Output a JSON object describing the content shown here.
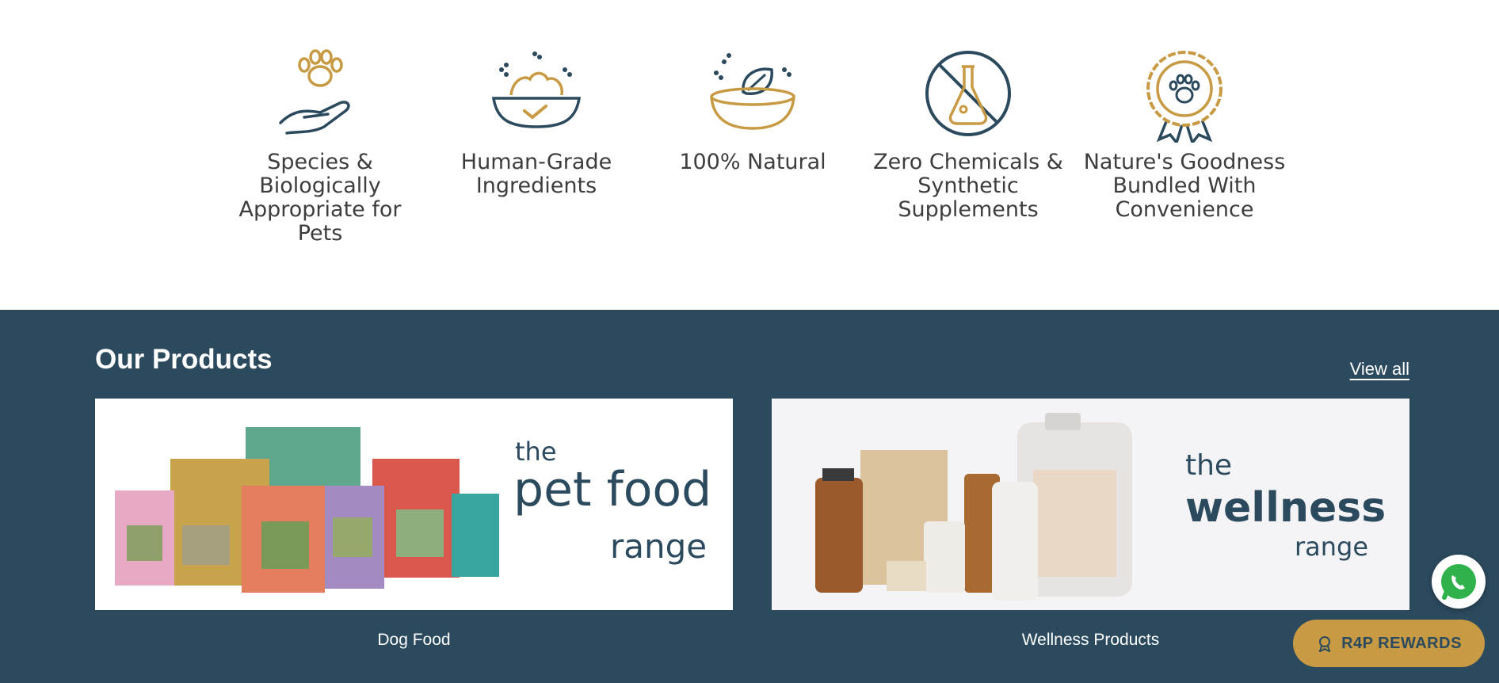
{
  "features": [
    {
      "icon": "paw-hand-icon",
      "label": "Species & Biologically Appropriate for Pets"
    },
    {
      "icon": "food-bowl-check-icon",
      "label": "Human-Grade Ingredients"
    },
    {
      "icon": "leaf-bowl-icon",
      "label": "100% Natural"
    },
    {
      "icon": "no-chemicals-icon",
      "label": "Zero Chemicals & Synthetic Supplements"
    },
    {
      "icon": "paw-badge-icon",
      "label": "Nature's Goodness Bundled With Convenience"
    }
  ],
  "products": {
    "title": "Our Products",
    "view_all": "View all",
    "cards": [
      {
        "caption": "Dog Food",
        "banner": {
          "the": "the",
          "main": "pet food",
          "range": "range"
        }
      },
      {
        "caption": "Wellness Products",
        "banner": {
          "the": "the",
          "main": "wellness",
          "range": "range"
        }
      }
    ]
  },
  "floating": {
    "whatsapp_icon": "whatsapp-icon",
    "rewards_label": "R4P REWARDS"
  },
  "colors": {
    "navy": "#2c4a5e",
    "gold": "#c79a43",
    "text": "#3d3d3d"
  }
}
